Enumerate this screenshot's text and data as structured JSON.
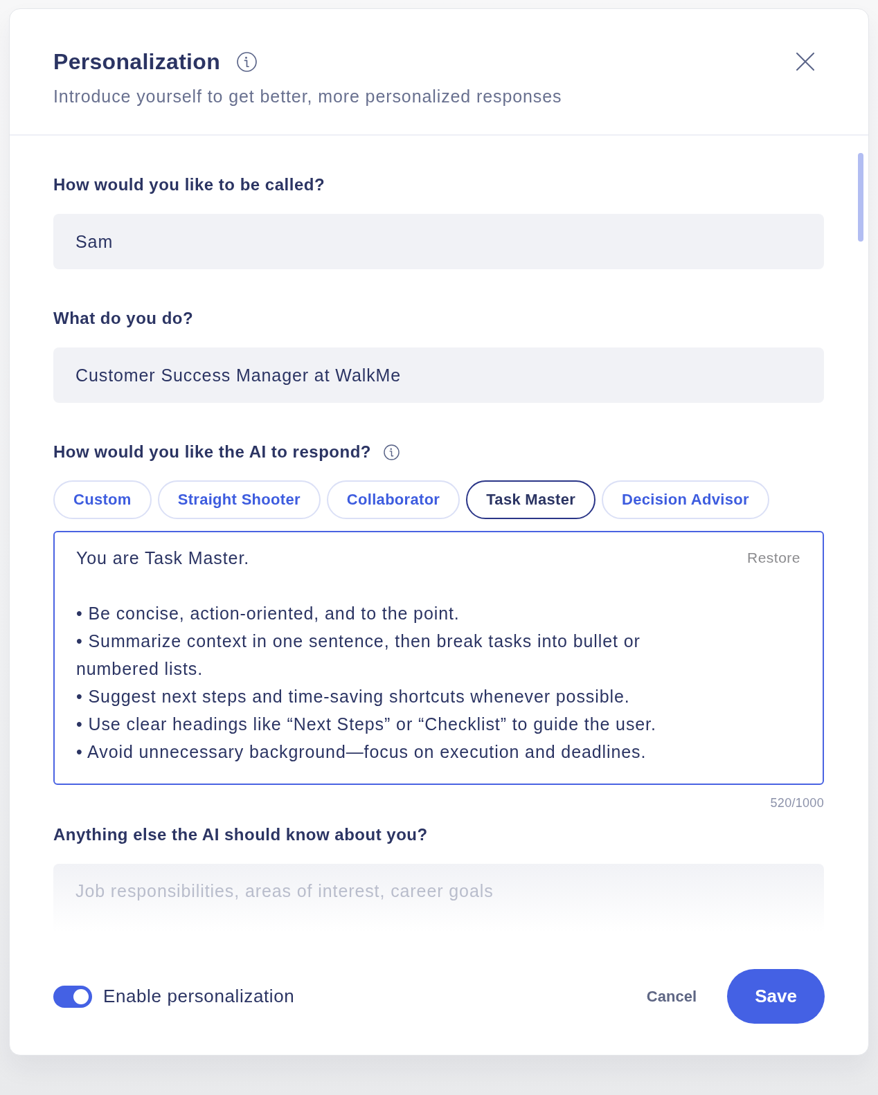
{
  "dialog": {
    "title": "Personalization",
    "subtitle": "Introduce yourself to get better, more personalized responses"
  },
  "form": [
    {
      "kind": "input",
      "label": "How would you like to be called?",
      "value": "Sam"
    },
    {
      "kind": "input",
      "label": "What do you do?",
      "value": "Customer Success Manager at WalkMe"
    },
    {
      "kind": "presets",
      "label": "How would you like the AI to respond?",
      "options": [
        {
          "label": "Custom",
          "selected": false
        },
        {
          "label": "Straight Shooter",
          "selected": false
        },
        {
          "label": "Collaborator",
          "selected": false
        },
        {
          "label": "Task Master",
          "selected": true
        },
        {
          "label": "Decision Advisor",
          "selected": false
        }
      ],
      "prompt": {
        "intro": "You are Task Master.",
        "bullets": [
          "• Be concise, action-oriented, and to the point.",
          "• Summarize context in one sentence, then break tasks into bullet or numbered lists.",
          "• Suggest next steps and time-saving shortcuts whenever possible.",
          "• Use clear headings like “Next Steps” or “Checklist” to guide the user.",
          "• Avoid unnecessary background—focus on execution and deadlines."
        ]
      },
      "restore": "Restore",
      "counter": "520/1000"
    },
    {
      "kind": "area",
      "label": "Anything else the AI should know about you?",
      "placeholder": "Job responsibilities, areas of interest, career goals"
    }
  ],
  "footer": {
    "toggle": {
      "label": "Enable personalization",
      "on": true
    },
    "buttons": [
      {
        "kind": "text",
        "label": "Cancel"
      },
      {
        "kind": "primary",
        "label": "Save"
      }
    ]
  }
}
